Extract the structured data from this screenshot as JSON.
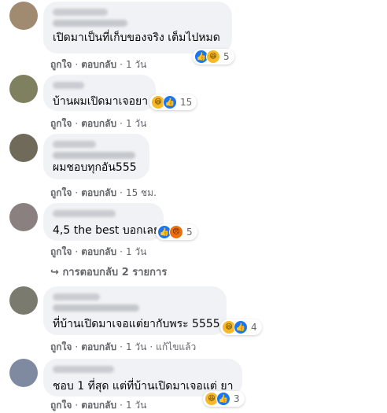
{
  "comments": [
    {
      "text": "เปิดมาเป็นที่เก็บของจริง เต็มไปหมด",
      "reactions": [
        "like",
        "haha"
      ],
      "count": "5",
      "like": "ถูกใจ",
      "reply": "ตอบกลับ",
      "time": "1 วัน"
    },
    {
      "text": "บ้านผมเปิดมาเจอยา",
      "reactions": [
        "haha",
        "like"
      ],
      "count": "15",
      "like": "ถูกใจ",
      "reply": "ตอบกลับ",
      "time": "1 วัน"
    },
    {
      "text": "ผมชอบทุกอัน555",
      "reactions": [],
      "count": "",
      "like": "ถูกใจ",
      "reply": "ตอบกลับ",
      "time": "15 ชม."
    },
    {
      "text": "4,5 the best บอกเลย",
      "reactions": [
        "like",
        "angry"
      ],
      "count": "5",
      "like": "ถูกใจ",
      "reply": "ตอบกลับ",
      "time": "1 วัน",
      "replies": "การตอบกลับ 2 รายการ"
    },
    {
      "text": "ที่บ้านเปิดมาเจอแต่ยากับพระ 5555",
      "reactions": [
        "haha",
        "like"
      ],
      "count": "4",
      "like": "ถูกใจ",
      "reply": "ตอบกลับ",
      "time": "1 วัน",
      "edited": "แก้ไขแล้ว"
    },
    {
      "text": "ชอบ 1 ที่สุด แต่ที่บ้านเปิดมาเจอแต่ ยา",
      "reactions": [
        "haha",
        "like"
      ],
      "count": "3",
      "like": "ถูกใจ",
      "reply": "ตอบกลับ",
      "time": "1 วัน"
    }
  ],
  "icons": {
    "like": "thumbs-up-icon",
    "haha": "laughing-face-icon",
    "angry": "angry-face-icon",
    "reply_arrow": "reply-arrow-icon"
  },
  "colors": {
    "bubble": "#f0f2f5",
    "meta": "#65676b",
    "like": "#1877f2",
    "haha": "#f7b928",
    "angry": "#e9710f"
  }
}
